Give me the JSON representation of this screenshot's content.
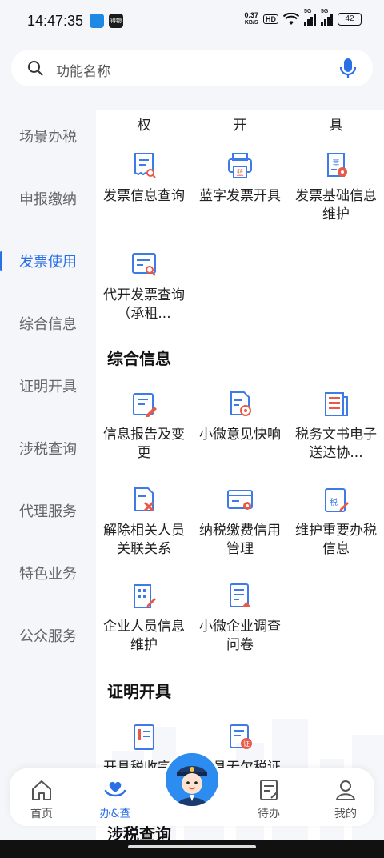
{
  "status_bar": {
    "time": "14:47:35",
    "badge_label": "得物",
    "net_speed_value": "0.37",
    "net_speed_unit": "KB/S",
    "hd": "HD",
    "signal_1": "5G",
    "signal_2": "5G",
    "battery": "42"
  },
  "search": {
    "placeholder": "功能名称"
  },
  "sidebar": {
    "items": [
      {
        "label": "场景办税"
      },
      {
        "label": "申报缴纳"
      },
      {
        "label": "发票使用"
      },
      {
        "label": "综合信息"
      },
      {
        "label": "证明开具"
      },
      {
        "label": "涉税查询"
      },
      {
        "label": "代理服务"
      },
      {
        "label": "特色业务"
      },
      {
        "label": "公众服务"
      }
    ],
    "active_index": 2
  },
  "content": {
    "truncated_top": [
      "权",
      "开",
      "具"
    ],
    "invoice_items": [
      {
        "label": "发票信息查询",
        "icon": "invoice-search-icon"
      },
      {
        "label": "蓝字发票开具",
        "icon": "blue-invoice-icon"
      },
      {
        "label": "发票基础信息维护",
        "icon": "invoice-maintain-icon"
      },
      {
        "label": "代开发票查询（承租...",
        "icon": "agent-invoice-search-icon"
      }
    ],
    "section_info_title": "综合信息",
    "info_items": [
      {
        "label": "信息报告及变更",
        "icon": "report-edit-icon"
      },
      {
        "label": "小微意见快响",
        "icon": "feedback-icon"
      },
      {
        "label": "税务文书电子送达协...",
        "icon": "document-delivery-icon"
      },
      {
        "label": "解除相关人员关联关系",
        "icon": "unlink-icon"
      },
      {
        "label": "纳税缴费信用管理",
        "icon": "credit-card-icon"
      },
      {
        "label": "维护重要办税信息",
        "icon": "tax-info-edit-icon"
      },
      {
        "label": "企业人员信息维护",
        "icon": "company-staff-icon"
      },
      {
        "label": "小微企业调查问卷",
        "icon": "survey-icon"
      }
    ],
    "section_cert_title": "证明开具",
    "cert_items": [
      {
        "label": "开具税收完税证明",
        "icon": "tax-certificate-icon"
      },
      {
        "label": "开具无欠税证明",
        "icon": "no-arrears-certificate-icon"
      }
    ],
    "section_query_title": "涉税查询"
  },
  "bottom_nav": {
    "tabs": [
      {
        "label": "首页"
      },
      {
        "label": "办&查"
      },
      {
        "label": "待办"
      },
      {
        "label": "我的"
      }
    ],
    "active_index": 1
  },
  "colors": {
    "accent": "#2b6fe6",
    "icon_blue": "#3d7be8",
    "icon_red": "#e8594a"
  }
}
